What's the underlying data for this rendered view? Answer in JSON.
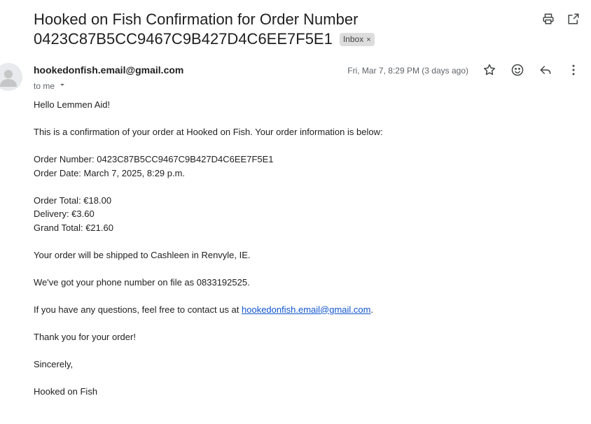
{
  "email": {
    "subject_line1": "Hooked on Fish Confirmation for Order Number",
    "subject_line2": "0423C87B5CC9467C9B427D4C6EE7F5E1",
    "label": "Inbox",
    "label_close": "×",
    "sender": "hookedonfish.email@gmail.com",
    "to": "to me",
    "date": "Fri, Mar 7, 8:29 PM (3 days ago)"
  },
  "icons": {
    "print": "print-icon",
    "open_new": "open-in-new-window-icon",
    "star": "star-icon",
    "emoji": "emoji-reaction-icon",
    "reply": "reply-icon",
    "more": "more-vertical-icon",
    "avatar": "default-avatar-icon",
    "dropdown": "caret-down-icon"
  },
  "body": {
    "greeting": "Hello Lemmen Aid!",
    "intro": "This is a confirmation of your order at Hooked on Fish. Your order information is below:",
    "order_number": "Order Number: 0423C87B5CC9467C9B427D4C6EE7F5E1",
    "order_date": "Order Date: March 7, 2025, 8:29 p.m.",
    "order_total": "Order Total: €18.00",
    "delivery": "Delivery: €3.60",
    "grand_total": "Grand Total: €21.60",
    "shipping": "Your order will be shipped to Cashleen in Renvyle, IE.",
    "phone": "We've got your phone number on file as 0833192525.",
    "questions_prefix": "If you have any questions, feel free to contact us at ",
    "contact_email": "hookedonfish.email@gmail.com",
    "questions_suffix": ".",
    "thanks": "Thank you for your order!",
    "closing": "Sincerely,",
    "signature": "Hooked on Fish"
  },
  "colors": {
    "link": "#1155cc",
    "badge_bg": "#dddddd",
    "secondary_text": "#5f6368"
  }
}
